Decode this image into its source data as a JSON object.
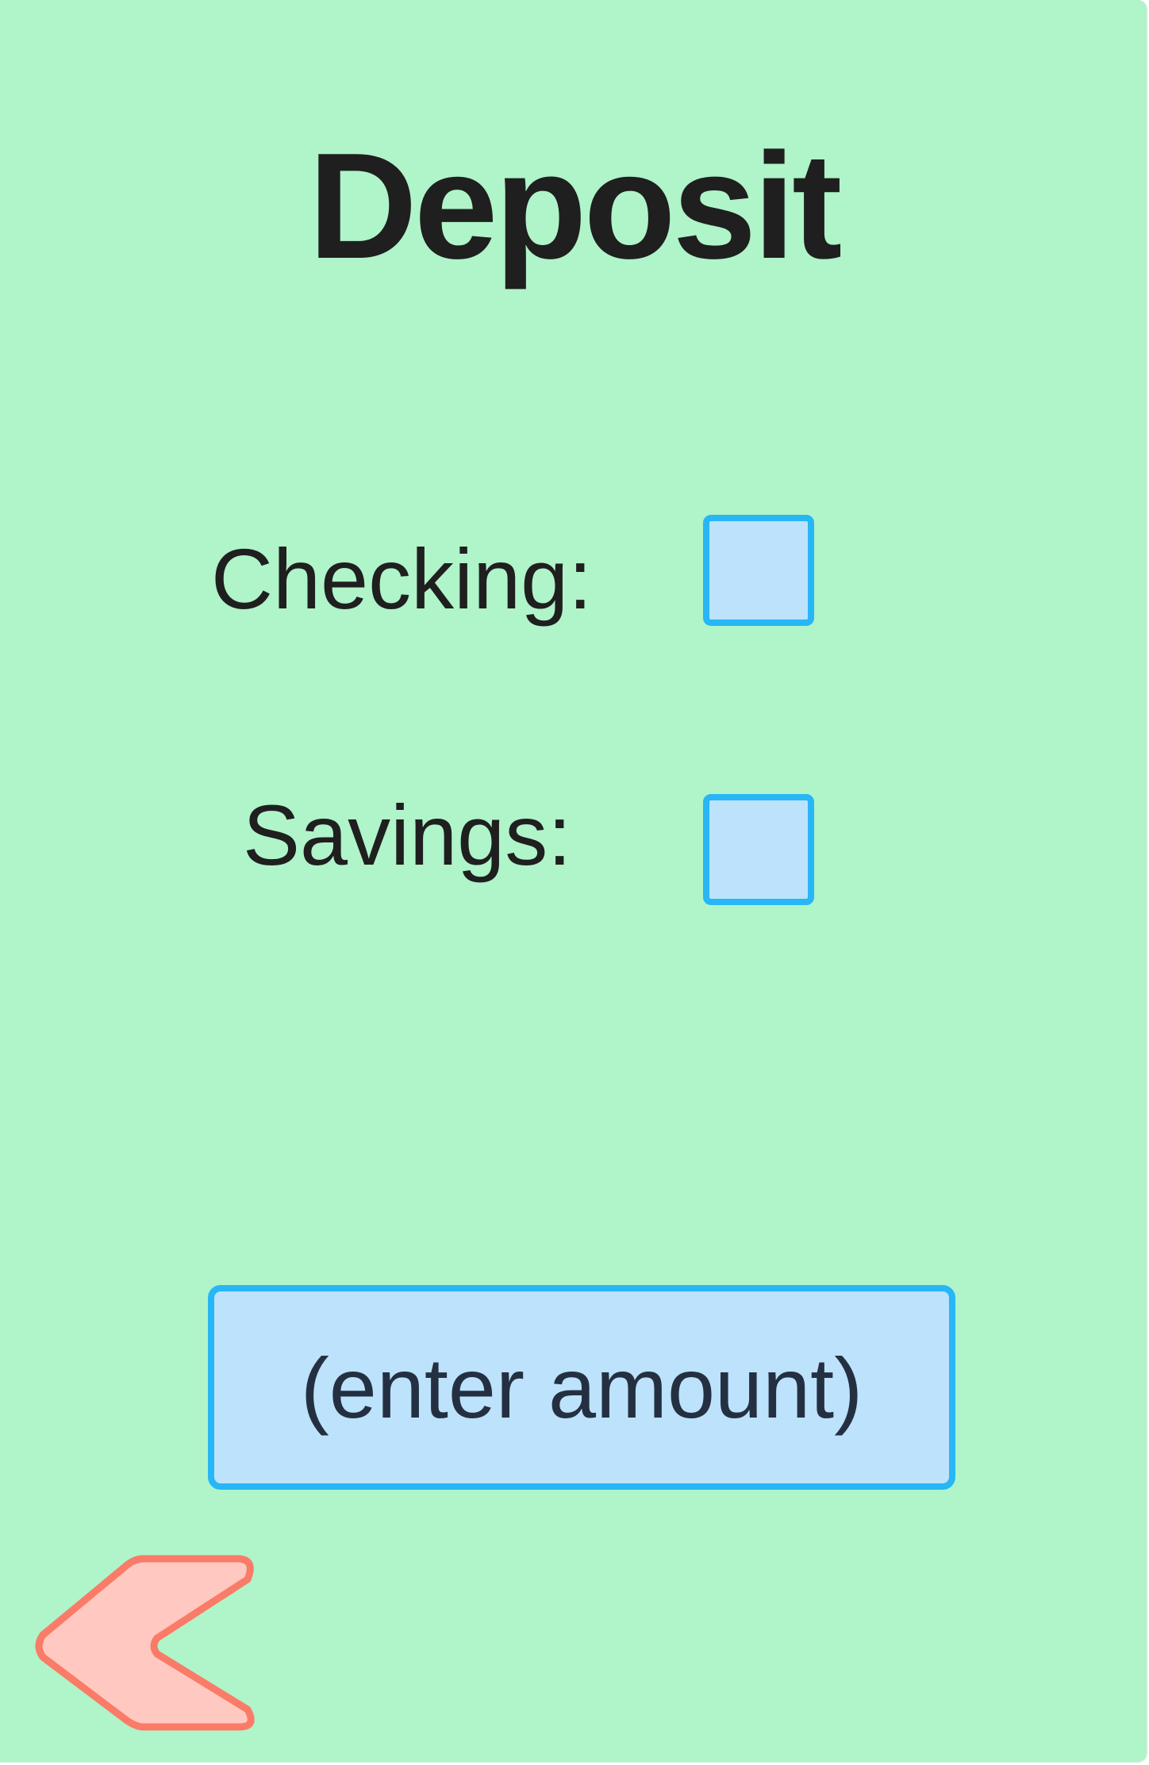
{
  "screen": {
    "title": "Deposit",
    "options": [
      {
        "label": "Checking:",
        "checked": false
      },
      {
        "label": "Savings:",
        "checked": false
      }
    ],
    "amount_placeholder": "(enter amount)",
    "back_icon": "chevron-left-icon"
  },
  "colors": {
    "background": "#b0f4c9",
    "control_fill": "#bde2fb",
    "control_border": "#27b6f6",
    "back_fill": "#ffc8c0",
    "back_border": "#fa7b68",
    "text": "#1f1f1f"
  }
}
